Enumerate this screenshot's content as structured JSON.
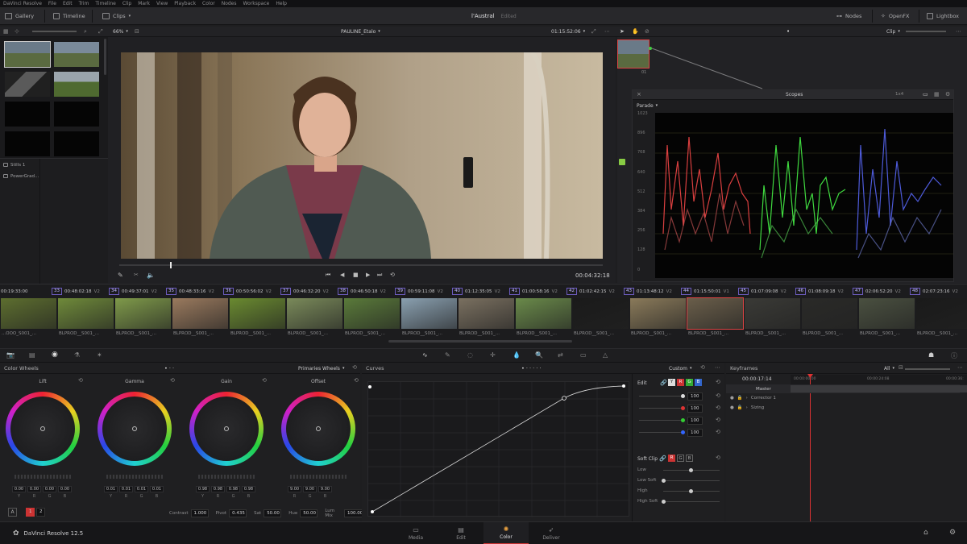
{
  "menubar": {
    "items": [
      "DaVinci Resolve",
      "File",
      "Edit",
      "Trim",
      "Timeline",
      "Clip",
      "Mark",
      "View",
      "Playback",
      "Color",
      "Nodes",
      "Workspace",
      "Help"
    ]
  },
  "toolbar": {
    "gallery": "Gallery",
    "timeline": "Timeline",
    "clips": "Clips",
    "project_title": "l'Austral",
    "project_status": "Edited",
    "nodes": "Nodes",
    "openfx": "OpenFX",
    "lightbox": "Lightbox"
  },
  "viewerbar": {
    "zoom": "66%",
    "clip_name": "PAULINE_Etalo",
    "timecode": "01:15:52:06",
    "mode": "Clip"
  },
  "gallery": {
    "album_stills": "Stills 1",
    "album_powergrade": "PowerGrad..."
  },
  "viewer": {
    "playhead_timecode": "00:04:32:18"
  },
  "scopes": {
    "title": "Scopes",
    "type": "Parade",
    "layout": "1x4",
    "ticks": [
      "1023",
      "896",
      "768",
      "640",
      "512",
      "384",
      "256",
      "128",
      "0"
    ]
  },
  "timeline": {
    "clips": [
      {
        "num": "",
        "tc": "00:19:33:00",
        "track": "",
        "label": "...OOO_S001_..."
      },
      {
        "num": "33",
        "tc": "00:48:02:18",
        "track": "V2",
        "label": "BLPROD__S001_..."
      },
      {
        "num": "34",
        "tc": "00:49:37:01",
        "track": "V2",
        "label": "BLPROD__S001_..."
      },
      {
        "num": "35",
        "tc": "00:48:33:16",
        "track": "V2",
        "label": "BLPROD__S001_..."
      },
      {
        "num": "36",
        "tc": "00:50:56:02",
        "track": "V2",
        "label": "BLPROD__S001_..."
      },
      {
        "num": "37",
        "tc": "00:46:32:20",
        "track": "V2",
        "label": "BLPROD__S001_..."
      },
      {
        "num": "38",
        "tc": "00:46:50:18",
        "track": "V2",
        "label": "BLPROD__S001_..."
      },
      {
        "num": "39",
        "tc": "00:59:11:08",
        "track": "V2",
        "label": "BLPROD__S001_..."
      },
      {
        "num": "40",
        "tc": "01:12:35:05",
        "track": "V2",
        "label": "BLPROD__S001_..."
      },
      {
        "num": "41",
        "tc": "01:00:58:16",
        "track": "V2",
        "label": "BLPROD__S001_..."
      },
      {
        "num": "42",
        "tc": "01:02:42:15",
        "track": "V2",
        "label": "BLPROD__S001_..."
      },
      {
        "num": "43",
        "tc": "01:13:48:12",
        "track": "V2",
        "label": "BLPROD__S001_..."
      },
      {
        "num": "44",
        "tc": "01:15:50:01",
        "track": "V1",
        "label": "BLPROD__S001_..."
      },
      {
        "num": "45",
        "tc": "01:07:09:08",
        "track": "V2",
        "label": "BLPROD__S001_..."
      },
      {
        "num": "46",
        "tc": "01:08:09:18",
        "track": "V2",
        "label": "BLPROD__S001_..."
      },
      {
        "num": "47",
        "tc": "02:06:52:20",
        "track": "V2",
        "label": "BLPROD__S001_..."
      },
      {
        "num": "48",
        "tc": "02:07:23:16",
        "track": "V2",
        "label": "BLPROD__S001_..."
      }
    ],
    "clip_colors": [
      "#5d6e2f",
      "#6f8a3a",
      "#7f9a4a",
      "#9a7a5e",
      "#6a8a30",
      "#7a8a5a",
      "#5a7a3a",
      "#8aa0b0",
      "#7a7060",
      "#6a8a4a",
      "#1a1a1a",
      "#8a7a5a",
      "#6a5e4a",
      "#3a3a36",
      "#2a2a28",
      "#4a5040",
      "#1a1a1a"
    ],
    "selected_index": 12
  },
  "color_wheels": {
    "title": "Color Wheels",
    "mode": "Primaries Wheels",
    "wheels": [
      {
        "name": "Lift",
        "values": [
          "0.00",
          "0.00",
          "0.00",
          "0.00"
        ]
      },
      {
        "name": "Gamma",
        "values": [
          "0.01",
          "0.01",
          "0.01",
          "0.01"
        ]
      },
      {
        "name": "Gain",
        "values": [
          "0.98",
          "0.98",
          "0.98",
          "0.98"
        ]
      },
      {
        "name": "Offset",
        "values": [
          "9.00",
          "9.00",
          "9.00",
          ""
        ]
      }
    ],
    "channel_labels": [
      "Y",
      "R",
      "G",
      "B"
    ],
    "offset_labels": [
      "R",
      "G",
      "B"
    ],
    "pages": [
      "1",
      "2"
    ],
    "mode_button": "A",
    "contrast_label": "Contrast",
    "contrast": "1.000",
    "pivot_label": "Pivot",
    "pivot": "0.435",
    "sat_label": "Sat",
    "sat": "50.00",
    "hue_label": "Hue",
    "hue": "50.00",
    "lummix_label": "Lum Mix",
    "lummix": "100.00"
  },
  "curves": {
    "title": "Curves",
    "preset": "Custom",
    "edit_label": "Edit",
    "edit_values": [
      "100",
      "100",
      "100",
      "100"
    ],
    "edit_channels": [
      "Y",
      "R",
      "G",
      "B"
    ],
    "softclip_label": "Soft Clip",
    "softclip_rows": [
      "Low",
      "Low Soft",
      "High",
      "High Soft"
    ]
  },
  "keyframes": {
    "title": "Keyframes",
    "filter": "All",
    "timecode": "00:00:17:14",
    "ruler": [
      "00:00:00:00",
      "00:00:24:08",
      "00:00:36:"
    ],
    "rows": [
      "Master",
      "Corrector 1",
      "Sizing"
    ]
  },
  "bottombar": {
    "app_name": "DaVinci Resolve 12.5",
    "pages": [
      "Media",
      "Edit",
      "Color",
      "Deliver"
    ],
    "active_page": "Color"
  }
}
